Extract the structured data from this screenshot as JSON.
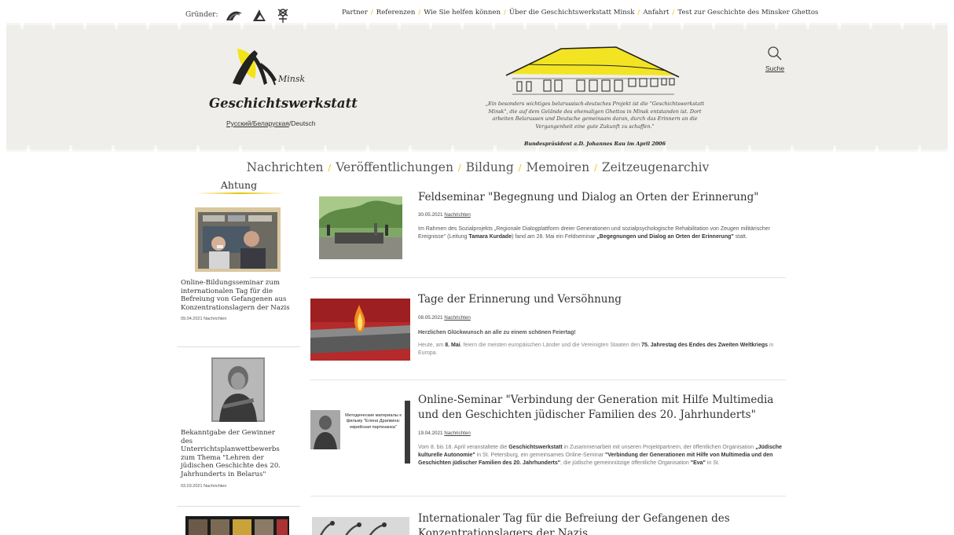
{
  "topbar": {
    "founders_label": "Gründer:",
    "founder_icons": [
      "founder-logo-1-icon",
      "founder-logo-2-icon",
      "founder-logo-3-icon"
    ],
    "links": [
      "Partner",
      "Referenzen",
      "Wie Sie helfen können",
      "Über die Geschichtswerkstatt Minsk",
      "Anfahrt",
      "Test zur Geschichte des Minsker Ghettos"
    ]
  },
  "header": {
    "logo_script": "Minsk",
    "site_title": "Geschichtswerkstatt",
    "lang_ru_by": "Русский/Беларуская",
    "lang_sep": "/",
    "lang_de": "Deutsch",
    "quote": "„Ein besonders wichtiges belarussisch-deutsches Projekt ist die \"Geschichtswerkstatt Minsk\", die auf dem Gelände des ehemaligen Ghettos in Minsk entstanden ist. Dort arbeiten Belarussen und Deutsche gemeinsam daran, durch das Erinnern an die Vergangenheit eine gute Zukunft zu schaffen.\"",
    "quote_author": "Bundespräsident a.D. Johannes Rau im April 2006",
    "search_label": "Suche"
  },
  "mainnav": [
    "Nachrichten",
    "Veröffentlichungen",
    "Bildung",
    "Memoiren",
    "Zeitzeugenarchiv"
  ],
  "sidebar": {
    "title": "Ahtung",
    "items": [
      {
        "text": "Online-Bildungsseminar zum internationalen Tag für die Befreiung von Gefangenen aus Konzentrationslagern der Nazis",
        "date": "09.04.2021",
        "category": "Nachrichten"
      },
      {
        "text": "Bekanntgabe der Gewinner des Unterrichtsplanwettbewerbs zum Thema \"Lehren der jüdischen Geschichte des 20. Jahrhunderts in Belarus\"",
        "date": "03.03.2021",
        "category": "Nachrichten"
      }
    ]
  },
  "articles": [
    {
      "title": "Feldseminar \"Begegnung und Dialog an Orten der Erinnerung\"",
      "date": "30.05.2021",
      "category": "Nachrichten",
      "body_1": "Im Rahmen des Sozialprojekts „Regionale Dialogplattform dreier Generationen und sozialpsychologische Rehabilitation von Zeugen militärischer Ereignisse\" (Leitung ",
      "body_b1": "Tamara Kurdade",
      "body_2": ") fand am 28. Mai ein Feldseminar ",
      "body_b2": "„Begegnungen und Dialog an Orten der Erinnerung\"",
      "body_3": " statt."
    },
    {
      "title": "Tage der Erinnerung und Versöhnung",
      "date": "08.05.2021",
      "category": "Nachrichten",
      "lead": "Herzlichen Glückwunsch an alle zu einem schönen Feiertag!",
      "body_1": "Heute, am ",
      "body_b1": "8. Mai",
      "body_2": ", feiern die meisten europäischen Länder und die Vereinigten Staaten den ",
      "body_b2": "75. Jahrestag des Endes des Zweiten Weltkriegs",
      "body_3": " in Europa."
    },
    {
      "title": "Online-Seminar \"Verbindung der Generation mit Hilfe Multimedia und den Geschichten jüdischer Familien des 20. Jahrhunderts\"",
      "date": "19.04.2021",
      "category": "Nachrichten",
      "thumb_caption": "Методические материалы к фильму \"Елена Драпкина: еврейская партизанка\"",
      "body_1": "Vom 8. bis 18. April veranstaltete die ",
      "body_b1": "Geschichtswerkstatt",
      "body_2": " in Zusammenarbeit mit unseren Projektpartnern, der öffentlichen Organisation ",
      "body_b2": "„Jüdische kulturelle Autonomie\"",
      "body_3": " in St. Petersburg, ein gemeinsames Online-Seminar ",
      "body_b3": "\"Verbindung der Generationen mit Hilfe von Multimedia und den Geschichten jüdischer Familien des 20. Jahrhunderts\"",
      "body_4": ", die jüdische gemeinnützige öffentliche Organisation ",
      "body_b4": "\"Eva\"",
      "body_5": " in St."
    },
    {
      "title": "Internationaler Tag für die Befreiung der Gefangenen des Konzentrationslagers der Nazis"
    }
  ],
  "colors": {
    "accent": "#e8c300",
    "banner_bg": "#efeeea",
    "text": "#333333"
  }
}
